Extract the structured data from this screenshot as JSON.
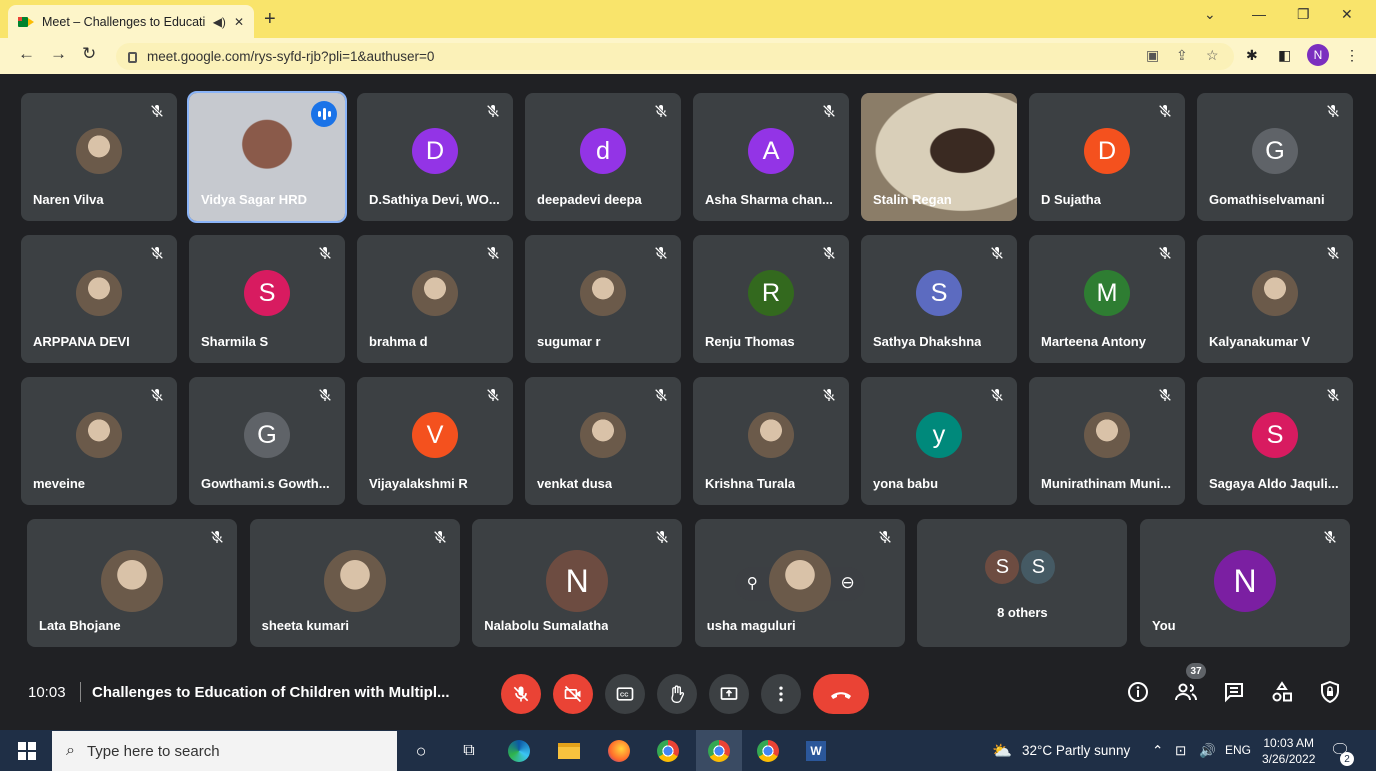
{
  "browser": {
    "tab_title": "Meet – Challenges to Educati",
    "url": "meet.google.com/rys-syfd-rjb?pli=1&authuser=0",
    "profile_initial": "N"
  },
  "meeting": {
    "time": "10:03",
    "title": "Challenges to Education of Children with Multipl...",
    "participant_count": "37",
    "others_label": "8 others",
    "others_initials": [
      "S",
      "S"
    ]
  },
  "tiles_row1": [
    {
      "name": "Naren Vilva",
      "avatar": "photo"
    },
    {
      "name": "Vidya Sagar HRD",
      "avatar": "video"
    },
    {
      "name": "D.Sathiya Devi, WO...",
      "initial": "D",
      "color": "#9334e6"
    },
    {
      "name": "deepadevi deepa",
      "initial": "d",
      "color": "#9334e6"
    },
    {
      "name": "Asha Sharma chan...",
      "initial": "A",
      "color": "#9334e6"
    },
    {
      "name": "Stalin Regan",
      "avatar": "video"
    },
    {
      "name": "D Sujatha",
      "initial": "D",
      "color": "#f4511e"
    },
    {
      "name": "Gomathiselvamani",
      "initial": "G",
      "color": "#5f6368"
    }
  ],
  "tiles_row2": [
    {
      "name": "ARPPANA DEVI",
      "avatar": "photo"
    },
    {
      "name": "Sharmila S",
      "initial": "S",
      "color": "#d81b60"
    },
    {
      "name": "brahma d",
      "avatar": "photo"
    },
    {
      "name": "sugumar r",
      "avatar": "photo"
    },
    {
      "name": "Renju Thomas",
      "initial": "R",
      "color": "#33691e"
    },
    {
      "name": "Sathya Dhakshna",
      "initial": "S",
      "color": "#5c6bc0"
    },
    {
      "name": "Marteena Antony",
      "initial": "M",
      "color": "#2e7d32"
    },
    {
      "name": "Kalyanakumar V",
      "avatar": "photo"
    }
  ],
  "tiles_row3": [
    {
      "name": "meveine",
      "avatar": "photo"
    },
    {
      "name": "Gowthami.s Gowth...",
      "initial": "G",
      "color": "#5f6368"
    },
    {
      "name": "Vijayalakshmi R",
      "initial": "V",
      "color": "#f4511e"
    },
    {
      "name": "venkat dusa",
      "avatar": "photo"
    },
    {
      "name": "Krishna Turala",
      "avatar": "photo"
    },
    {
      "name": "yona babu",
      "initial": "y",
      "color": "#00897b"
    },
    {
      "name": "Munirathinam Muni...",
      "avatar": "photo"
    },
    {
      "name": "Sagaya Aldo Jaquli...",
      "initial": "S",
      "color": "#d81b60"
    }
  ],
  "tiles_row4": [
    {
      "name": "Lata Bhojane",
      "avatar": "photo"
    },
    {
      "name": "sheeta kumari",
      "avatar": "photo"
    },
    {
      "name": "Nalabolu Sumalatha",
      "initial": "N",
      "color": "#6d4c41"
    },
    {
      "name": "usha maguluri",
      "avatar": "photo"
    },
    {
      "name": "You",
      "initial": "N",
      "color": "#7b1fa2"
    }
  ],
  "taskbar": {
    "search_placeholder": "Type here to search",
    "weather": "32°C  Partly sunny",
    "lang": "ENG",
    "time": "10:03 AM",
    "date": "3/26/2022",
    "notif_count": "2"
  },
  "colors": {
    "tab_bar": "#f9e46b",
    "tile_bg": "#3c4043",
    "stage_bg": "#202124",
    "danger": "#ea4335",
    "taskbar": "#1f2f46"
  }
}
